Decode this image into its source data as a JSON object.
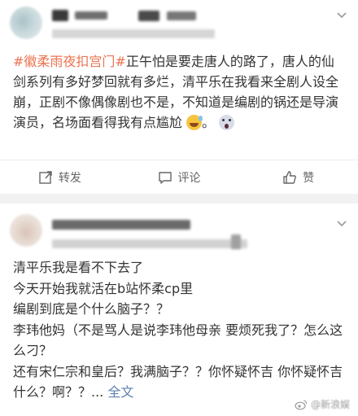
{
  "post1": {
    "hashtag": "#徽柔雨夜扣宫门#",
    "text": "正午怕是要走唐人的路了，唐人的仙剑系列有多好梦回就有多烂，清平乐在我看来全剧人设全崩，正剧不像偶像剧也不是，不知道是编剧的锅还是导演演员，名场面看得我有点尴尬",
    "emojis": [
      "sweat-smile-icon",
      "scream-face-icon"
    ],
    "text_end": "。",
    "actions": {
      "repost_label": "转发",
      "comment_label": "评论",
      "like_label": "赞"
    }
  },
  "post2": {
    "lines": [
      "清平乐我是看不下去了",
      "今天开始我就活在b站怀柔cp里",
      "编剧到底是个什么脑子？？",
      "李玮他妈（不是骂人是说李玮他母亲 要烦死我了？怎么这么刁？",
      "还有宋仁宗和皇后？我满脑子？？你怀疑怀吉 你怀疑怀吉什么？啊？？..."
    ],
    "full_text_label": "全文"
  },
  "watermark": {
    "text": "@新浪娱"
  },
  "colors": {
    "hashtag": "#eb7350",
    "link": "#5b7fb0",
    "background": "#f2f2f2"
  }
}
